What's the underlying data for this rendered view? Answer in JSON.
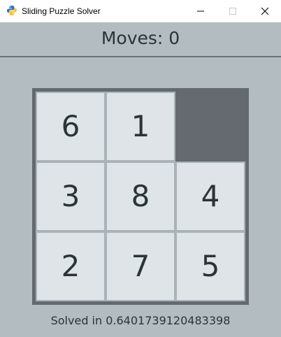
{
  "window": {
    "title": "Sliding Puzzle Solver",
    "icon": "python-icon"
  },
  "header": {
    "moves_text": "Moves: 0"
  },
  "board": {
    "tiles": [
      "6",
      "1",
      "",
      "3",
      "8",
      "4",
      "2",
      "7",
      "5"
    ]
  },
  "status": {
    "text": "Solved in 0.6401739120483398"
  },
  "colors": {
    "background": "#b3bcc0",
    "board": "#646a6f",
    "tile": "#dee4e7",
    "text": "#2b3437"
  }
}
